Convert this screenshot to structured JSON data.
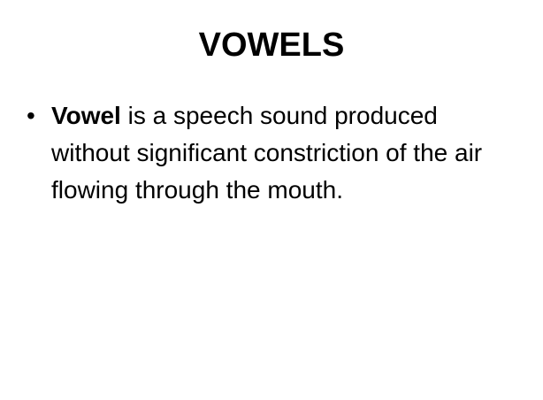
{
  "slide": {
    "title": "VOWELS",
    "bullets": [
      {
        "marker": "•",
        "term": "Vowel",
        "text": " is a speech sound produced without significant constriction of the air flowing through the mouth."
      }
    ]
  }
}
